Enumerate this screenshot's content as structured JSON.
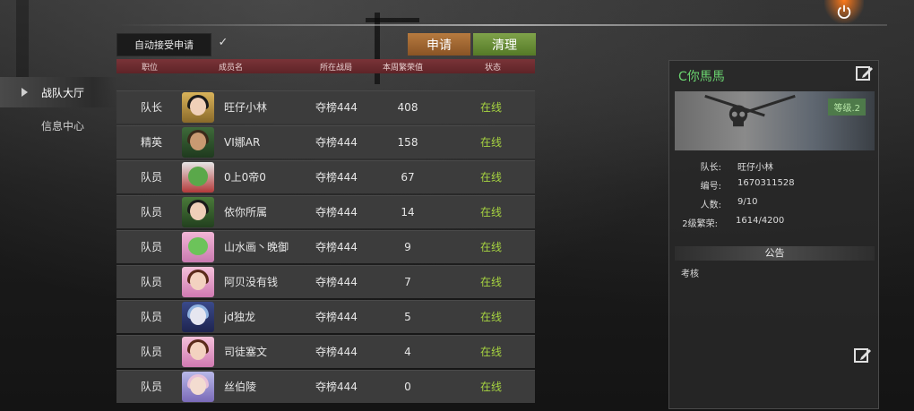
{
  "nav": {
    "items": [
      {
        "label": "战队大厅",
        "active": true
      },
      {
        "label": "信息中心",
        "active": false
      }
    ]
  },
  "controls": {
    "auto_accept_label": "自动接受申请",
    "auto_accept_checked": true,
    "checkmark": "✓",
    "apply_label": "申请",
    "clear_label": "清理"
  },
  "table": {
    "headers": {
      "role": "职位",
      "name": "成员名",
      "zone": "所在战局",
      "score": "本周繁荣值",
      "status": "状态"
    },
    "rows": [
      {
        "role": "队长",
        "name": "旺仔小林",
        "zone": "夺榜444",
        "score": "408",
        "status": "在线"
      },
      {
        "role": "精英",
        "name": "VI娜AR",
        "zone": "夺榜444",
        "score": "158",
        "status": "在线"
      },
      {
        "role": "队员",
        "name": "0上0帝0",
        "zone": "夺榜444",
        "score": "67",
        "status": "在线"
      },
      {
        "role": "队员",
        "name": "依你所属",
        "zone": "夺榜444",
        "score": "14",
        "status": "在线"
      },
      {
        "role": "队员",
        "name": "山水画丶晚御",
        "zone": "夺榜444",
        "score": "9",
        "status": "在线"
      },
      {
        "role": "队员",
        "name": "阿贝没有钱",
        "zone": "夺榜444",
        "score": "7",
        "status": "在线"
      },
      {
        "role": "队员",
        "name": "jd独龙",
        "zone": "夺榜444",
        "score": "5",
        "status": "在线"
      },
      {
        "role": "队员",
        "name": "司徒塞文",
        "zone": "夺榜444",
        "score": "4",
        "status": "在线"
      },
      {
        "role": "队员",
        "name": "丝伯陵",
        "zone": "夺榜444",
        "score": "0",
        "status": "在线"
      }
    ]
  },
  "team": {
    "name": "C你馬馬",
    "level_badge": "等级.2",
    "captain_label": "队长:",
    "captain_value": "旺仔小林",
    "id_label": "编号:",
    "id_value": "1670311528",
    "count_label": "人数:",
    "count_value": "9/10",
    "prosperity_label": "2级繁荣:",
    "prosperity_value": "1614/4200",
    "notice_title": "公告",
    "notice_text": "考核"
  },
  "colors": {
    "online": "#a6d340",
    "team_name": "#6ad36f",
    "apply_button": "#b67a3f",
    "clear_button": "#7fa24a",
    "header_bar": "#7a3338"
  },
  "icons": [
    "power-icon",
    "edit-icon",
    "checkmark-icon",
    "arrow-right-icon",
    "skull-emblem-icon"
  ]
}
